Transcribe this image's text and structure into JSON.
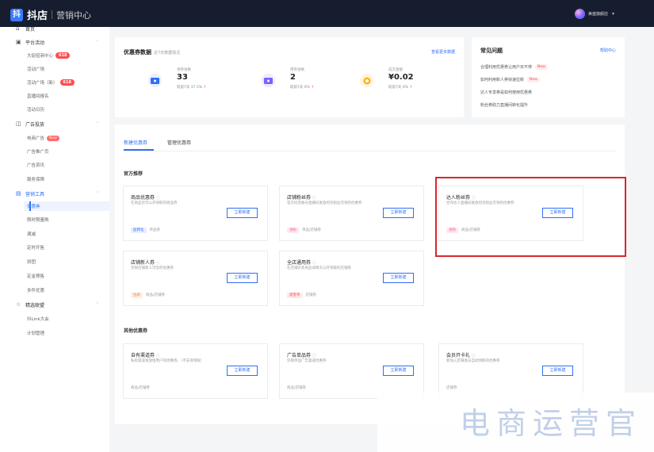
{
  "topbar": {
    "logo_icon": "抖",
    "app_name": "抖店",
    "section": "营销中心",
    "user_name": "美盛旗舰店",
    "caret": "▾"
  },
  "sidebar": {
    "home": "首页",
    "platform_group": "平台活动",
    "platform_items": [
      {
        "label": "大促招商中心",
        "badge": "618"
      },
      {
        "label": "活动广场",
        "badge": ""
      },
      {
        "label": "活动广场（新）",
        "badge": "618"
      },
      {
        "label": "直播间报名",
        "badge": ""
      },
      {
        "label": "活动日历",
        "badge": ""
      }
    ],
    "ads_group": "广告投放",
    "ads_items": [
      {
        "label": "电商广告",
        "badge": "New"
      },
      {
        "label": "广告推广页",
        "badge": ""
      },
      {
        "label": "广告资讯",
        "badge": ""
      },
      {
        "label": "服务保障",
        "badge": ""
      }
    ],
    "tools_group": "营销工具",
    "tools_items": [
      {
        "label": "优惠券"
      },
      {
        "label": "限时限量购"
      },
      {
        "label": "满减"
      },
      {
        "label": "定时开售"
      },
      {
        "label": "拼团"
      },
      {
        "label": "定金预售"
      },
      {
        "label": "多件优惠"
      }
    ],
    "union_group": "精选联盟",
    "union_items": [
      {
        "label": "抖Link大会"
      },
      {
        "label": "计划管理"
      }
    ]
  },
  "stats": {
    "title": "优惠券数据",
    "subtitle": "近7天数据情况",
    "more": "查看更多数据",
    "items": [
      {
        "label": "领券张数",
        "value": "33",
        "sub": "较前7天 37.5%",
        "trend": "↑",
        "color": "#2f6ff5"
      },
      {
        "label": "用券张数",
        "value": "2",
        "sub": "较前7天 0%",
        "trend": "↑",
        "color": "#7b61ff"
      },
      {
        "label": "成交金额",
        "value": "¥0.02",
        "sub": "较前7天 0%",
        "trend": "↑",
        "color": "#ffb020"
      }
    ]
  },
  "faq": {
    "title": "常见问题",
    "help": "帮助中心",
    "items": [
      {
        "text": "合理利用优惠券让用户买不停",
        "new": "New"
      },
      {
        "text": "如何利用新人券快速拉新",
        "new": "New"
      },
      {
        "text": "达人专享券是如何使用优惠券",
        "new": ""
      },
      {
        "text": "粉丝券助力直播间转化提升",
        "new": ""
      }
    ]
  },
  "main": {
    "tabs": [
      "新建优惠券",
      "管理优惠券"
    ],
    "official_title": "官方推荐",
    "other_title": "其他优惠券",
    "create_label": "立即新建",
    "official_coupons": [
      {
        "name": "商品优惠券",
        "desc": "在商品页可公开领取的商品券",
        "tags": [
          {
            "t": "促转化",
            "c": "blue"
          },
          {
            "t": "单品券",
            "c": "plain"
          }
        ]
      },
      {
        "name": "店铺粉丝券",
        "desc": "官方抖音账号直播间发放的仅粉丝可领的优惠券",
        "tags": [
          {
            "t": "涨粉",
            "c": "pink"
          },
          {
            "t": "单品/店铺券",
            "c": "plain"
          }
        ]
      },
      {
        "name": "达人粉丝券",
        "desc": "合作达人直播间发放的仅粉丝可领的优惠券",
        "tags": [
          {
            "t": "涨粉",
            "c": "pink"
          },
          {
            "t": "商品/店铺券",
            "c": "plain"
          }
        ]
      },
      {
        "name": "店铺新人券",
        "desc": "仅限店铺新人可见的优惠券",
        "tags": [
          {
            "t": "拉新",
            "c": "orange"
          },
          {
            "t": "商品/店铺券",
            "c": "plain"
          }
        ]
      },
      {
        "name": "全店通用券",
        "desc": "在店铺页及商品详情页公开领取的店铺券",
        "tags": [
          {
            "t": "提客单",
            "c": "red"
          },
          {
            "t": "店铺券",
            "c": "plain"
          }
        ]
      }
    ],
    "other_coupons": [
      {
        "name": "自有渠道券",
        "desc": "私有渠道发放给用户的优惠券。（不支持领取）",
        "tags": [
          {
            "t": "商品/店铺券",
            "c": "plain"
          }
        ]
      },
      {
        "name": "广告单品券",
        "desc": "仅限单品广告渠道优惠券",
        "tags": [
          {
            "t": "商品/店铺券",
            "c": "plain"
          }
        ]
      },
      {
        "name": "会员开卡礼",
        "desc": "新加入店铺会员自动领取的优惠券",
        "tags": [
          {
            "t": "店铺券",
            "c": "plain"
          }
        ]
      }
    ]
  },
  "watermark": "电商运营官"
}
